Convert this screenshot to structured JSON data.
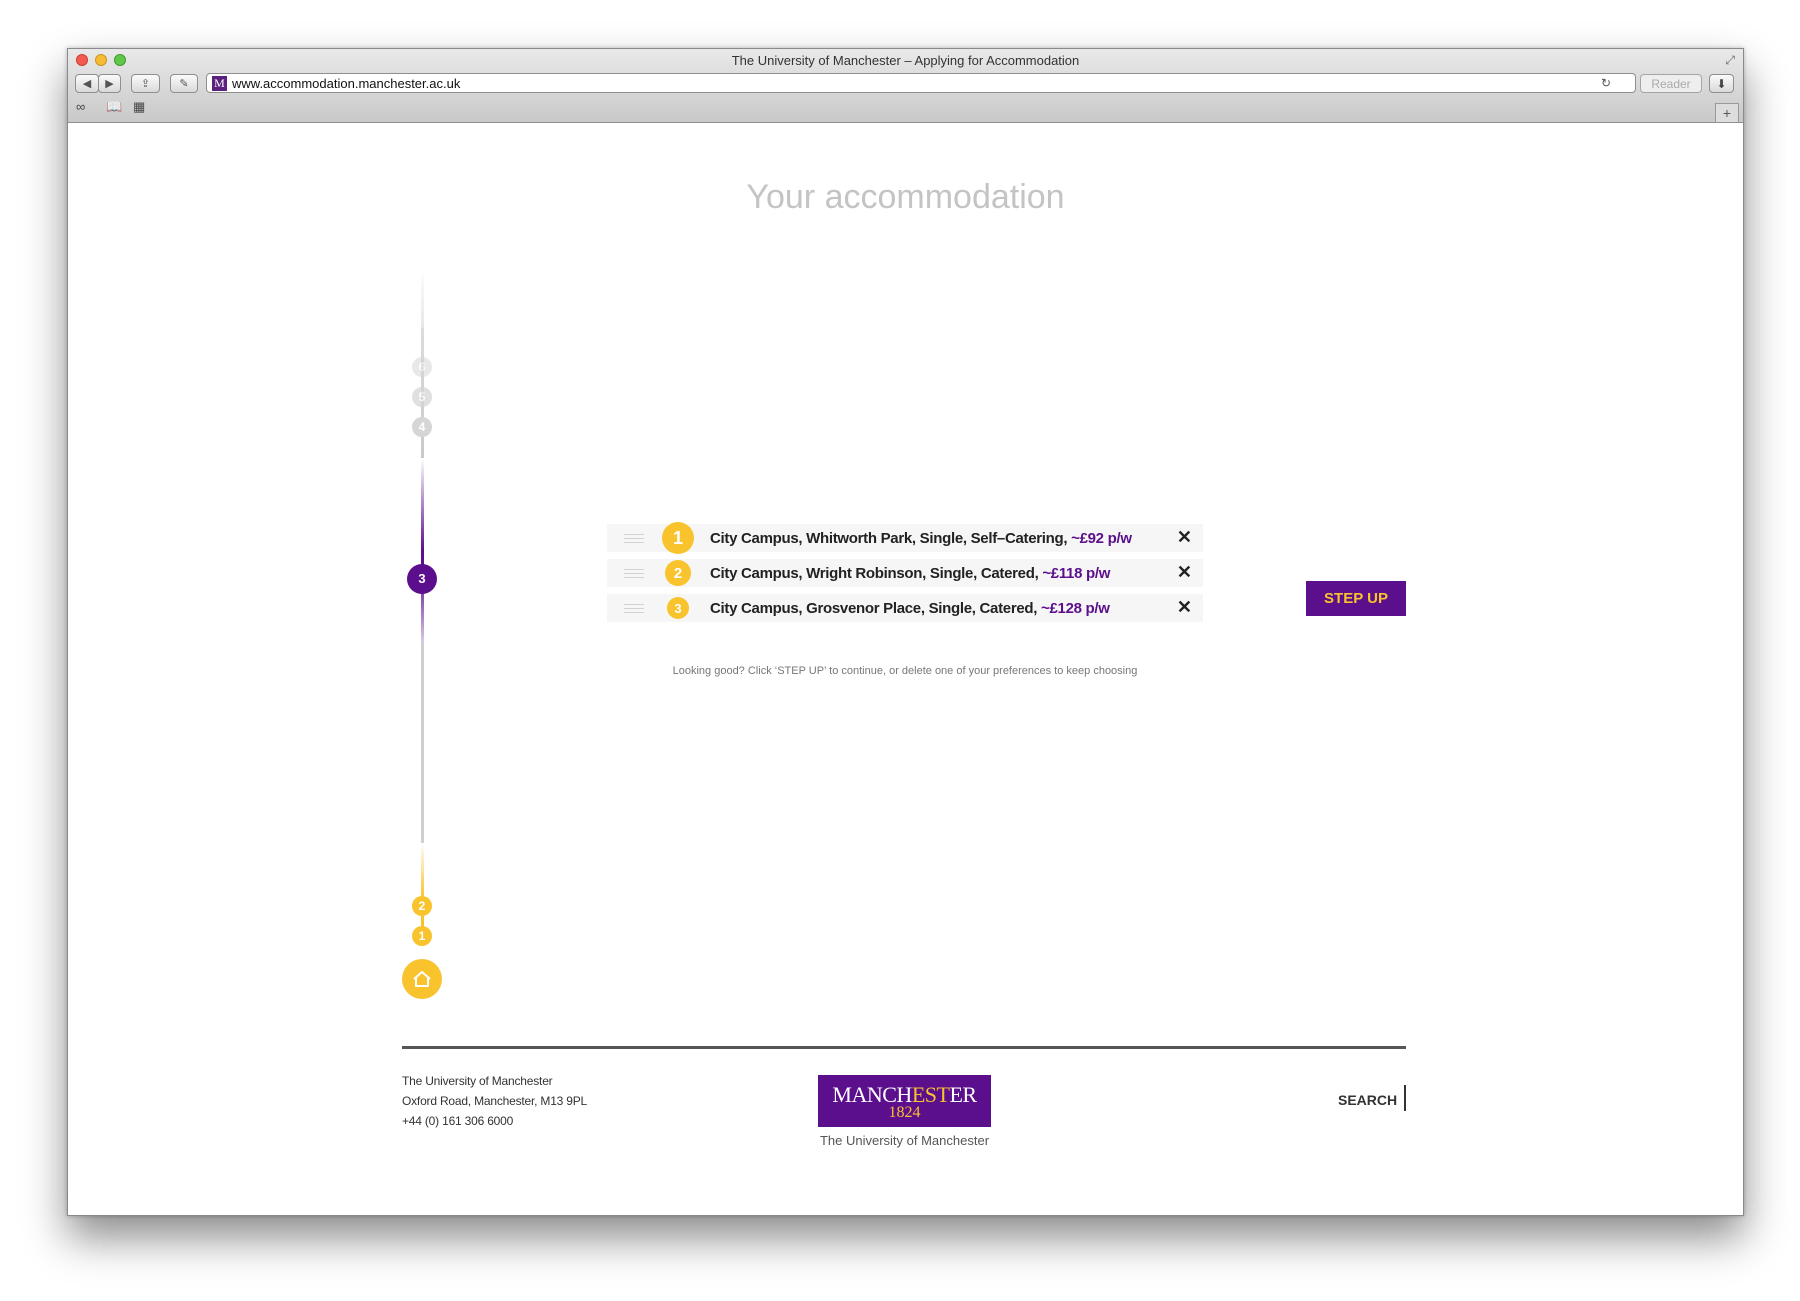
{
  "window": {
    "title": "The University of Manchester – Applying for Accommodation",
    "url": "www.accommodation.manchester.ac.uk",
    "reader_label": "Reader",
    "favicon_letter": "M"
  },
  "page": {
    "title": "Your accommodation"
  },
  "timeline": {
    "upcoming": [
      "6",
      "5",
      "4"
    ],
    "current": "3",
    "completed": [
      "2",
      "1"
    ]
  },
  "preferences": [
    {
      "rank": "1",
      "text": "City Campus, Whitworth Park, Single, Self–Catering,",
      "price": "~£92 p/w"
    },
    {
      "rank": "2",
      "text": "City Campus, Wright Robinson, Single, Catered,",
      "price": "~£118 p/w"
    },
    {
      "rank": "3",
      "text": "City Campus, Grosvenor Place, Single, Catered,",
      "price": "~£128 p/w"
    }
  ],
  "hint": "Looking good? Click ‘STEP UP’ to continue, or delete one of your preferences to keep choosing",
  "step_up_label": "STEP UP",
  "footer": {
    "address_lines": [
      "The University of Manchester",
      "Oxford Road, Manchester, M13 9PL",
      "+44 (0) 161 306 6000"
    ],
    "logo_pre": "MANCH",
    "logo_est": "EST",
    "logo_post": "ER",
    "logo_year": "1824",
    "logo_sub": "The University of Manchester",
    "search_label": "SEARCH"
  },
  "colors": {
    "purple": "#5b0f8c",
    "yellow": "#f8c32d"
  }
}
